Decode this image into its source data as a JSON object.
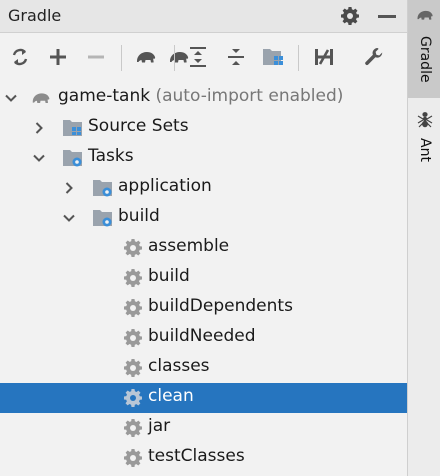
{
  "window": {
    "title": "Gradle"
  },
  "toolbar": {
    "buttons": [
      {
        "icon": "refresh-icon"
      },
      {
        "icon": "plus-icon"
      },
      {
        "icon": "minus-icon"
      },
      {
        "icon": "elephant-icon"
      },
      {
        "icon": "elephant-run-icon"
      },
      {
        "icon": "expand-all-icon"
      },
      {
        "icon": "collapse-all-icon"
      },
      {
        "icon": "group-modules-icon"
      },
      {
        "icon": "toggle-offline-icon"
      },
      {
        "icon": "wrench-icon"
      }
    ]
  },
  "tree": {
    "project": {
      "name": "game-tank",
      "suffix": "(auto-import enabled)"
    },
    "source_sets": "Source Sets",
    "tasks": "Tasks",
    "application": "application",
    "build": "build",
    "build_tasks": [
      "assemble",
      "build",
      "buildDependents",
      "buildNeeded",
      "classes",
      "clean",
      "jar",
      "testClasses"
    ],
    "selected": "clean"
  },
  "sidebar": {
    "tabs": [
      {
        "label": "Gradle",
        "active": true
      },
      {
        "label": "Ant",
        "active": false
      }
    ]
  },
  "colors": {
    "selection": "#2675bf",
    "folder": "#9aa3ad",
    "module_blue": "#3b8fd9"
  }
}
